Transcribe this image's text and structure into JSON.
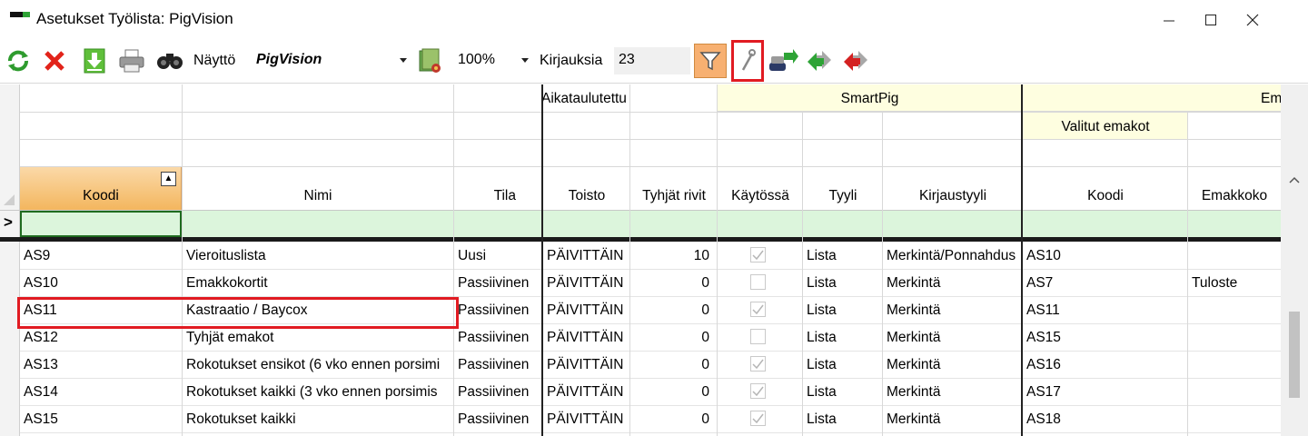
{
  "window": {
    "title": "Asetukset Työlista: PigVision",
    "minimize": "—",
    "maximize": "☐",
    "close": "✕"
  },
  "toolbar": {
    "display_label": "Näyttö",
    "display_value": "PigVision",
    "zoom_value": "100%",
    "records_label": "Kirjauksia",
    "records_count": "23",
    "icons": [
      "refresh-icon",
      "delete-icon",
      "download-icon",
      "print-icon",
      "binoculars-icon",
      "export-icon",
      "filter-icon",
      "wrench-icon",
      "transfer-icon",
      "arrow-green-icon",
      "arrow-red-icon"
    ]
  },
  "grid": {
    "group_headers": {
      "aikataulutettu": "Aikataulutettu",
      "smartpig": "SmartPig",
      "emakot_partial": "Em",
      "valitut_emakot": "Valitut emakot"
    },
    "columns": {
      "koodi": "Koodi",
      "nimi": "Nimi",
      "tila": "Tila",
      "toisto": "Toisto",
      "tyhjat_rivit": "Tyhjät rivit",
      "kaytossa": "Käytössä",
      "tyyli": "Tyyli",
      "kirjaustyyli": "Kirjaustyyli",
      "koodi2": "Koodi",
      "emakkokortti": "Emakkoko"
    },
    "sort_indicator": "▲",
    "new_row_marker": ">",
    "rows": [
      {
        "koodi": "AS9",
        "nimi": "Vieroituslista",
        "tila": "Uusi",
        "toisto": "PÄIVITTÄIN",
        "tyhjat": "10",
        "kaytossa": true,
        "tyyli": "Lista",
        "kirjaustyyli": "Merkintä/Ponnahdus",
        "koodi2": "AS10",
        "emakko": ""
      },
      {
        "koodi": "AS10",
        "nimi": "Emakkokortit",
        "tila": "Passiivinen",
        "toisto": "PÄIVITTÄIN",
        "tyhjat": "0",
        "kaytossa": false,
        "tyyli": "Lista",
        "kirjaustyyli": "Merkintä",
        "koodi2": "AS7",
        "emakko": "Tuloste"
      },
      {
        "koodi": "AS11",
        "nimi": "Kastraatio / Baycox",
        "tila": "Passiivinen",
        "toisto": "PÄIVITTÄIN",
        "tyhjat": "0",
        "kaytossa": true,
        "tyyli": "Lista",
        "kirjaustyyli": "Merkintä",
        "koodi2": "AS11",
        "emakko": ""
      },
      {
        "koodi": "AS12",
        "nimi": "Tyhjät emakot",
        "tila": "Passiivinen",
        "toisto": "PÄIVITTÄIN",
        "tyhjat": "0",
        "kaytossa": false,
        "tyyli": "Lista",
        "kirjaustyyli": "Merkintä",
        "koodi2": "AS15",
        "emakko": ""
      },
      {
        "koodi": "AS13",
        "nimi": "Rokotukset ensikot (6 vko ennen porsimi",
        "tila": "Passiivinen",
        "toisto": "PÄIVITTÄIN",
        "tyhjat": "0",
        "kaytossa": true,
        "tyyli": "Lista",
        "kirjaustyyli": "Merkintä",
        "koodi2": "AS16",
        "emakko": ""
      },
      {
        "koodi": "AS14",
        "nimi": "Rokotukset kaikki (3 vko ennen porsimis",
        "tila": "Passiivinen",
        "toisto": "PÄIVITTÄIN",
        "tyhjat": "0",
        "kaytossa": true,
        "tyyli": "Lista",
        "kirjaustyyli": "Merkintä",
        "koodi2": "AS17",
        "emakko": ""
      },
      {
        "koodi": "AS15",
        "nimi": "Rokotukset kaikki",
        "tila": "Passiivinen",
        "toisto": "PÄIVITTÄIN",
        "tyhjat": "0",
        "kaytossa": true,
        "tyyli": "Lista",
        "kirjaustyyli": "Merkintä",
        "koodi2": "AS18",
        "emakko": ""
      }
    ]
  },
  "colors": {
    "accent_highlight": "#e11b22",
    "sorted_header": "#f6c27d",
    "group_yellow": "#fefee0",
    "new_row_green": "#dcf5dc",
    "selected_filter": "#f7b071"
  }
}
